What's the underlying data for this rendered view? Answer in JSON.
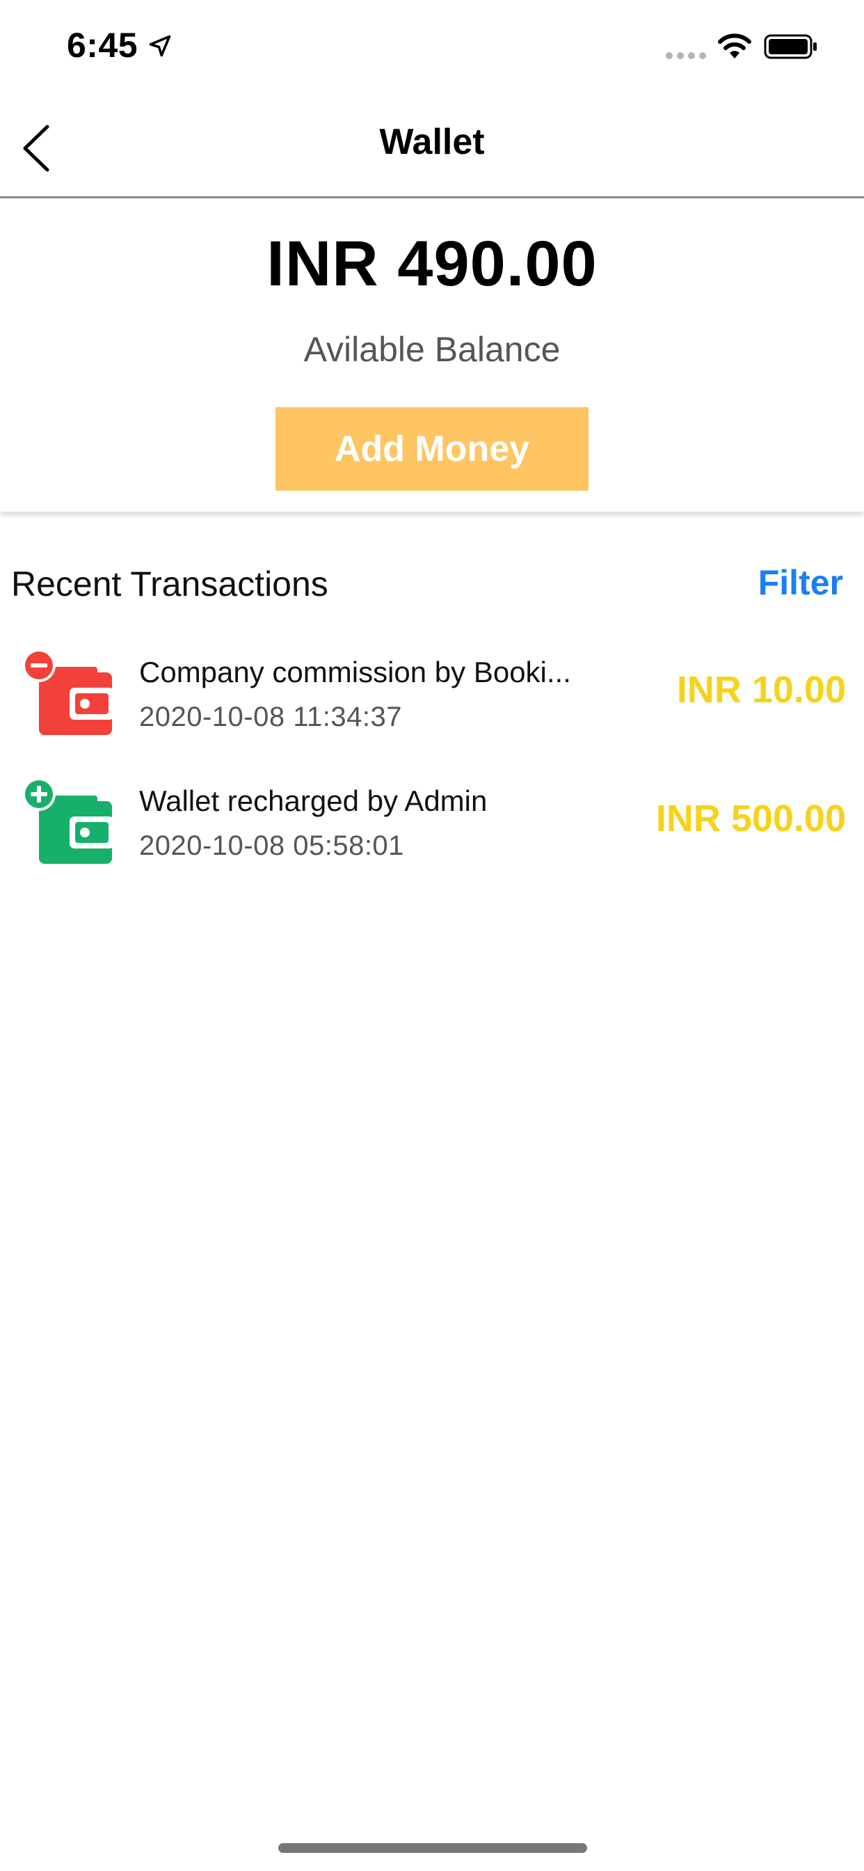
{
  "status_bar": {
    "time": "6:45"
  },
  "nav": {
    "title": "Wallet"
  },
  "balance": {
    "amount": "INR 490.00",
    "label": "Avilable Balance",
    "add_money_label": "Add Money"
  },
  "transactions": {
    "title": "Recent Transactions",
    "filter_label": "Filter",
    "items": [
      {
        "type": "debit",
        "description": "Company commission by Booki...",
        "date": "2020-10-08 11:34:37",
        "amount": "INR 10.00"
      },
      {
        "type": "credit",
        "description": "Wallet recharged by Admin",
        "date": "2020-10-08 05:58:01",
        "amount": "INR 500.00"
      }
    ]
  },
  "colors": {
    "accent_button": "#fec562",
    "filter_link": "#1a7ff0",
    "amount_text": "#f7d21c",
    "debit_icon": "#f2413a",
    "credit_icon": "#16b06a"
  },
  "icons": {
    "back": "chevron-left-icon",
    "location": "location-arrow-icon",
    "wifi": "wifi-icon",
    "battery": "battery-icon",
    "debit": "wallet-minus-icon",
    "credit": "wallet-plus-icon"
  }
}
